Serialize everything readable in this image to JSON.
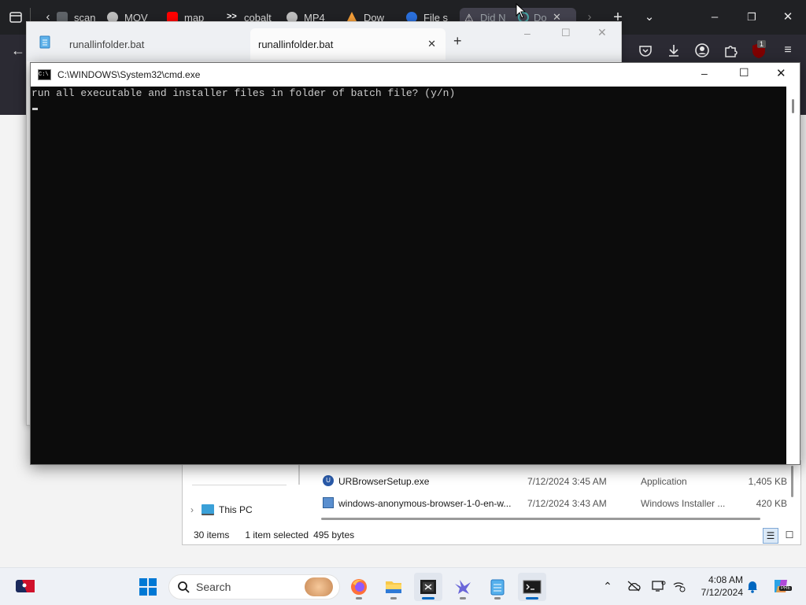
{
  "browser": {
    "tabs": [
      {
        "label": "scan",
        "color": "#5f6368"
      },
      {
        "label": "MOV",
        "color": "#bdbdbd"
      },
      {
        "label": "map",
        "color": "#ff0000"
      },
      {
        "label": "cobalt",
        "color": "#ffffff"
      },
      {
        "label": "MP4",
        "color": "#bdbdbd"
      },
      {
        "label": "Dow",
        "color": "#f29d38"
      },
      {
        "label": "File s",
        "color": "#2a6fdb"
      },
      {
        "label": "Did N",
        "color": "#dddddd"
      },
      {
        "label": "Do",
        "color": "#49a6a6"
      }
    ],
    "extension_badge": "1"
  },
  "notepad": {
    "tabs": [
      {
        "label": "runallinfolder.bat"
      },
      {
        "label": "runallinfolder.bat"
      }
    ],
    "new_tab": "+"
  },
  "cmd": {
    "title": "C:\\WINDOWS\\System32\\cmd.exe",
    "icon_text": "C:\\",
    "output_line": "run all executable and installer files in folder of batch file? (y/n)"
  },
  "explorer": {
    "nav": {
      "this_pc": "This PC"
    },
    "files": [
      {
        "name": "URBrowserSetup.exe",
        "date": "7/12/2024 3:45 AM",
        "type": "Application",
        "size": "1,405 KB",
        "icon_color": "#2a5aa8"
      },
      {
        "name": "windows-anonymous-browser-1-0-en-w...",
        "date": "7/12/2024 3:43 AM",
        "type": "Windows Installer ...",
        "size": "420 KB",
        "icon_color": "#5a8fcf"
      }
    ],
    "status": {
      "items": "30 items",
      "selected": "1 item selected",
      "size": "495 bytes"
    }
  },
  "taskbar": {
    "search_placeholder": "Search",
    "clock": {
      "time": "4:08 AM",
      "date": "7/12/2024"
    },
    "pre_badge": "PRE"
  }
}
